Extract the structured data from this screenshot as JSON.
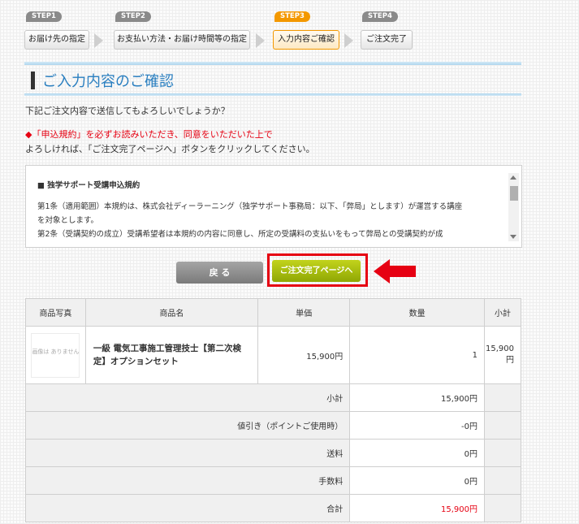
{
  "steps": [
    {
      "tag": "STEP1",
      "label": "お届け先の指定",
      "active": false
    },
    {
      "tag": "STEP2",
      "label": "お支払い方法・お届け時間等の指定",
      "active": false
    },
    {
      "tag": "STEP3",
      "label": "入力内容ご確認",
      "active": true
    },
    {
      "tag": "STEP4",
      "label": "ご注文完了",
      "active": false
    }
  ],
  "page": {
    "title": "ご入力内容のご確認",
    "intro": "下記ご注文内容で送信してもよろしいでしょうか？",
    "notice": "◆「申込規約」を必ずお読みいただき、同意をいただいた上で",
    "notice_sub": "よろしければ、「ご注文完了ページへ」ボタンをクリックしてください。"
  },
  "terms": {
    "heading": "■ 独学サポート受講申込規約",
    "lines": [
      "第1条（適用範囲）本規約は、株式会社ディーラーニング（独学サポート事務局：以下、「弊局」とします）が運営する講座",
      "を対象とします。",
      "第2条（受講契約の成立）受講希望者は本規約の内容に同意し、所定の受講料の支払いをもって弊局との受講契約が成"
    ]
  },
  "buttons": {
    "back": "戻 る",
    "next": "ご注文完了ページへ"
  },
  "colors": {
    "highlight": "#e60012",
    "accent": "#2a7fc0",
    "next_button": "#9cb50a"
  },
  "table": {
    "headers": [
      "商品写真",
      "商品名",
      "単価",
      "数量",
      "小計"
    ],
    "product": {
      "photo_text": "画像は ありません",
      "name": "一級 電気工事施工管理技士【第二次検定】オプションセット",
      "price": "15,900円",
      "qty": "1",
      "subtotal": "15,900円"
    },
    "summary": [
      {
        "label": "小計",
        "value": "15,900円"
      },
      {
        "label": "値引き（ポイントご使用時）",
        "value": "-0円"
      },
      {
        "label": "送料",
        "value": "0円"
      },
      {
        "label": "手数料",
        "value": "0円"
      },
      {
        "label": "合計",
        "value": "15,900円"
      }
    ]
  }
}
